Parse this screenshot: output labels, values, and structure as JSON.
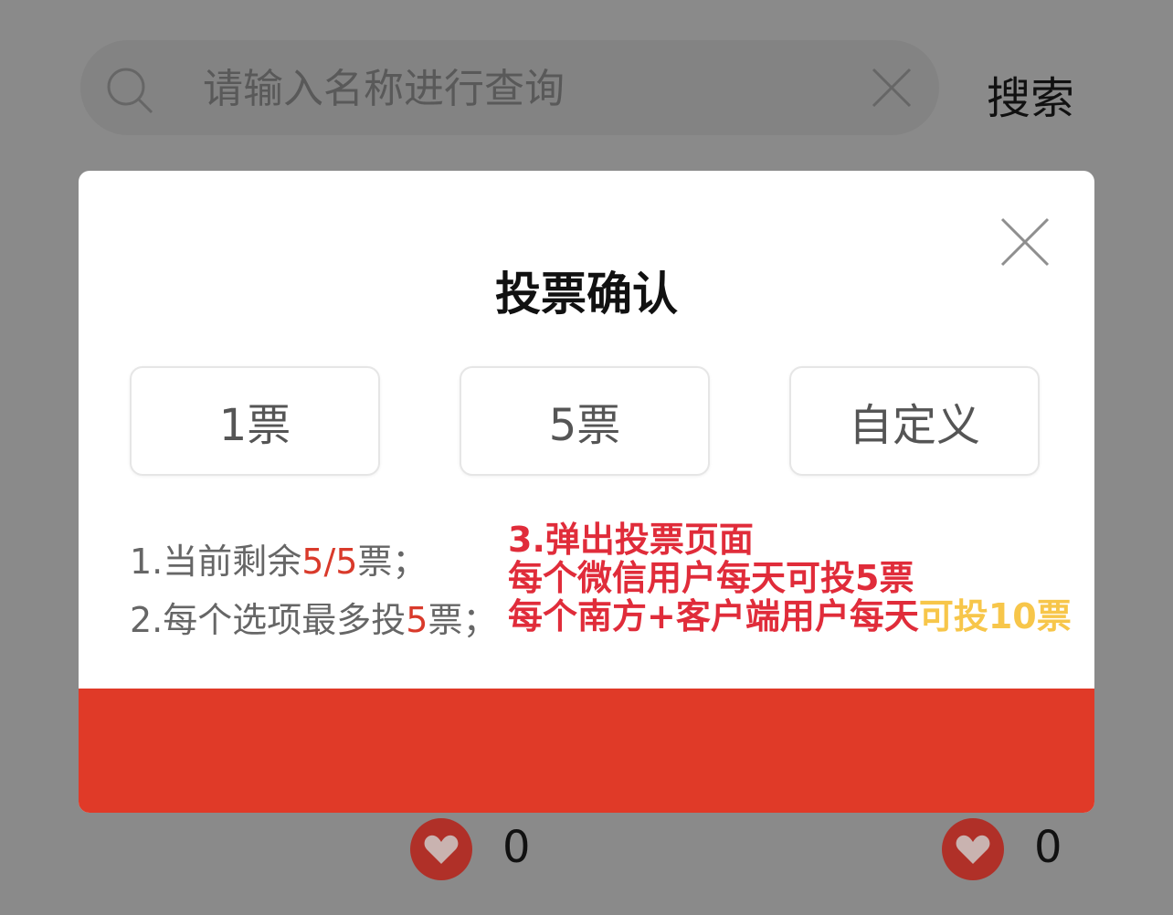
{
  "search": {
    "placeholder": "请输入名称进行查询",
    "button_label": "搜索"
  },
  "dialog": {
    "title": "投票确认",
    "options": [
      "1票",
      "5票",
      "自定义"
    ],
    "rules": {
      "line1": {
        "prefix": "1.当前剩余",
        "highlight": "5/5",
        "suffix": "票；"
      },
      "line2": {
        "prefix": "2.每个选项最多投",
        "highlight": "5",
        "suffix": "票；"
      }
    },
    "confirm_label": ""
  },
  "annotation": {
    "line1": "3.弹出投票页面",
    "line2": "每个微信用户每天可投5票",
    "line3_red": "每个南方+客户端用户每天",
    "line3_yellow": "可投10票"
  },
  "likes": [
    {
      "count": "0"
    },
    {
      "count": "0"
    }
  ],
  "colors": {
    "accent": "#e03a28",
    "overlay": "#8a8a8a",
    "annotation_red": "#e02c3a",
    "annotation_yellow": "#f7c64a"
  }
}
